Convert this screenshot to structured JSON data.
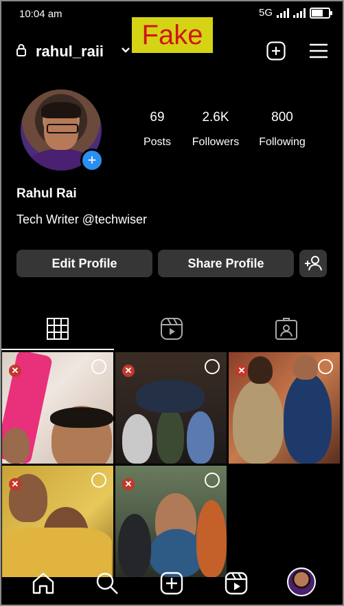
{
  "status_bar": {
    "time": "10:04 am",
    "network": "5G"
  },
  "watermark": {
    "text": "Fake"
  },
  "header": {
    "username": "rahul_raii"
  },
  "profile": {
    "stats": [
      {
        "value": "69",
        "label": "Posts"
      },
      {
        "value": "2.6K",
        "label": "Followers"
      },
      {
        "value": "800",
        "label": "Following"
      }
    ],
    "name": "Rahul Rai",
    "bio": "Tech Writer @techwiser"
  },
  "actions": {
    "edit_label": "Edit Profile",
    "share_label": "Share Profile"
  },
  "tabs": [
    {
      "icon": "grid-icon",
      "active": true
    },
    {
      "icon": "reels-icon",
      "active": false
    },
    {
      "icon": "tagged-icon",
      "active": false
    }
  ],
  "colors": {
    "accent": "#2c8ef0",
    "button_bg": "#363636",
    "remove_badge": "#c0392b"
  },
  "bottom_nav": [
    "home-icon",
    "search-icon",
    "create-icon",
    "reels-icon",
    "profile-avatar"
  ]
}
